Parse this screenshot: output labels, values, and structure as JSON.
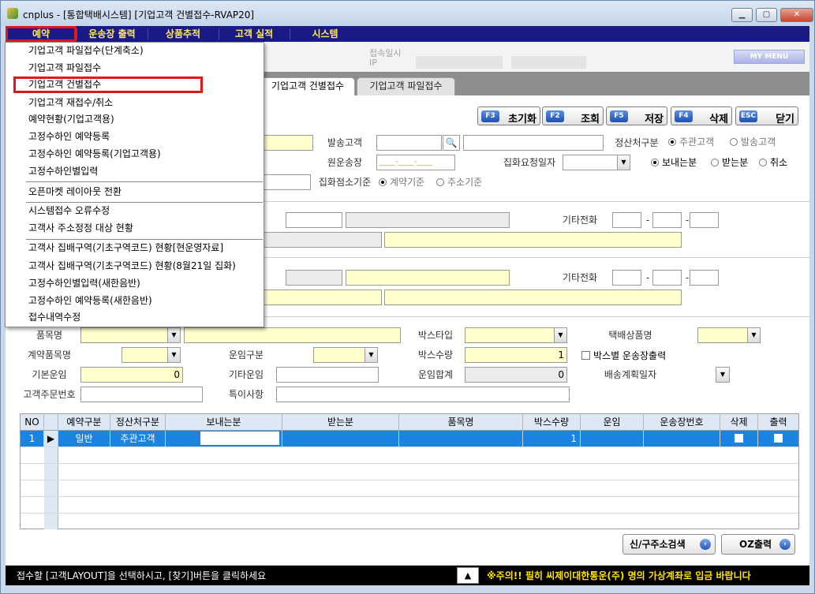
{
  "window": {
    "title": "cnplus - [통합택배시스템] [기업고객 건별접수-RVAP20]",
    "controls": {
      "minimize": "▁",
      "maximize": "▢",
      "close": "✕"
    }
  },
  "menu": {
    "items": [
      "예약",
      "운송장 출력",
      "상품추적",
      "고객 실적",
      "시스템"
    ],
    "colors": {
      "bar": "#1a1a86",
      "text": "#ffe95a",
      "highlight": "#e01818"
    }
  },
  "dropdown": {
    "items": [
      "기업고객 파일접수(단계축소)",
      "기업고객 파일접수",
      "기업고객 건별접수",
      "기업고객 재접수/취소",
      "예약현황(기업고객용)",
      "고정수하인 예약등록",
      "고정수하인 예약등록(기업고객용)",
      "고정수하인별입력",
      "오픈마켓 레이아웃 전환",
      "시스템접수 오류수정",
      "고객사 주소정정 대상 현황",
      "고객사 집배구역(기초구역코드) 현황[현운영자료]",
      "고객사 집배구역(기초구역코드) 현황(8월21일 집화)",
      "고정수하인별입력(새한음반)",
      "고정수하인 예약등록(새한음반)",
      "접수내역수정"
    ],
    "highlighted": "기업고객 건별접수"
  },
  "info": {
    "login_time_label": "접속일시",
    "ip_label": "IP",
    "my_menu": "MY MENU"
  },
  "tabs": [
    "기업고객 건별접수",
    "기업고객 파일접수"
  ],
  "toolbar": [
    {
      "key": "F3",
      "label": "초기화"
    },
    {
      "key": "F2",
      "label": "조회"
    },
    {
      "key": "F5",
      "label": "저장"
    },
    {
      "key": "F4",
      "label": "삭제"
    },
    {
      "key": "ESC",
      "label": "닫기"
    }
  ],
  "form": {
    "sender_label": "발송고객",
    "original_waybill_label": "원운송장",
    "original_waybill_placeholder": "____-____-____",
    "pickup_date_label": "집화요청일자",
    "settle_label": "정산처구분",
    "settle_options": [
      "주관고객",
      "발송고객"
    ],
    "direction_options": [
      "보내는분",
      "받는분",
      "취소"
    ],
    "pickup_branch_label": "집화점소기준",
    "pickup_branch_options": [
      "계약기준",
      "주소기준"
    ],
    "other_phone_label": "기타전화",
    "other_phone_label2": "기타전화",
    "phone_sep": "-",
    "item_name_label": "품목명",
    "box_type_label": "박스타입",
    "product_label": "택배상품명",
    "contract_item_label": "계약품목명",
    "freight_type_label": "운임구분",
    "box_qty_label": "박스수량",
    "box_qty_value": "1",
    "per_box_label": "박스별 운송장출력",
    "base_fare_label": "기본운임",
    "base_fare_value": "0",
    "other_fare_label": "기타운임",
    "total_fare_label": "운임합계",
    "total_fare_value": "0",
    "delivery_plan_label": "배송계획일자",
    "order_no_label": "고객주문번호",
    "special_label": "특이사항"
  },
  "grid": {
    "columns": [
      "NO",
      "예약구분",
      "정산처구분",
      "보내는분",
      "받는분",
      "품목명",
      "박스수량",
      "운임",
      "운송장번호",
      "삭제",
      "출력"
    ],
    "rows": [
      {
        "no": "1",
        "indicator": "▶",
        "type": "일반",
        "settle": "주관고객",
        "sender": "",
        "receiver": "",
        "item": "",
        "qty": "1",
        "fare": "",
        "waybill": ""
      }
    ]
  },
  "buttons": {
    "address_search": "신/구주소검색",
    "oz_print": "OZ출력"
  },
  "status": {
    "message": "접수할 [고객LAYOUT]을 선택하시고, [찾기]버튼을 클릭하세요",
    "up_arrow": "▲",
    "warning": "※주의!! 필히 씨제이대한통운(주) 명의 가상계좌로 입금 바랍니다"
  }
}
